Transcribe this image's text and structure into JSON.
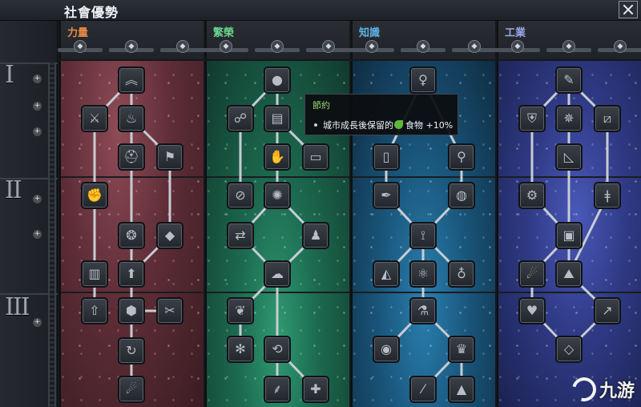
{
  "window": {
    "title": "社會優勢"
  },
  "tiers": [
    "I",
    "II",
    "III"
  ],
  "categories": [
    {
      "label": "力量",
      "color": "#e88a4a",
      "sub_icons": [
        "strength-sub-icon-1",
        "strength-sub-icon-2",
        "strength-sub-icon-3"
      ],
      "nodes": [
        {
          "icon": "chevron-rank-icon",
          "glyph": "︽"
        },
        {
          "icon": "sword-icon",
          "glyph": "⚔"
        },
        {
          "icon": "torch-icon",
          "glyph": "♨"
        },
        {
          "icon": "helmet-icon",
          "glyph": "⛑"
        },
        {
          "icon": "flag-icon",
          "glyph": "⚑"
        },
        {
          "icon": "fist-icon",
          "glyph": "✊"
        },
        {
          "icon": "swirl-icon",
          "glyph": "❂"
        },
        {
          "icon": "gem-icon",
          "glyph": "◆"
        },
        {
          "icon": "pillar-icon",
          "glyph": "▥"
        },
        {
          "icon": "arrow-up-icon",
          "glyph": "⬆"
        },
        {
          "icon": "arrow-up-circle-icon",
          "glyph": "⇧"
        },
        {
          "icon": "hexagon-icon",
          "glyph": "⬢"
        },
        {
          "icon": "crossed-blades-icon",
          "glyph": "✂"
        },
        {
          "icon": "cycle-icon",
          "glyph": "↻"
        },
        {
          "icon": "comet-icon",
          "glyph": "☄"
        }
      ]
    },
    {
      "label": "繁榮",
      "color": "#6ad38a",
      "sub_icons": [
        "prosperity-sub-icon-1",
        "prosperity-sub-icon-2",
        "prosperity-sub-icon-3"
      ],
      "nodes": [
        {
          "icon": "apple-icon",
          "glyph": "●"
        },
        {
          "icon": "handshake-icon",
          "glyph": "☍"
        },
        {
          "icon": "bar-growth-icon",
          "glyph": "▤"
        },
        {
          "icon": "hand-icon",
          "glyph": "✋"
        },
        {
          "icon": "book-icon",
          "glyph": "▭"
        },
        {
          "icon": "no-sign-icon",
          "glyph": "⊘"
        },
        {
          "icon": "sun-rays-icon",
          "glyph": "✺"
        },
        {
          "icon": "arrows-exchange-icon",
          "glyph": "⇄"
        },
        {
          "icon": "villager-icon",
          "glyph": "♟"
        },
        {
          "icon": "brain-icon",
          "glyph": "☁"
        },
        {
          "icon": "leaves-icon",
          "glyph": "❦"
        },
        {
          "icon": "snowflake-icon",
          "glyph": "✻"
        },
        {
          "icon": "cycle-leaf-icon",
          "glyph": "⟲"
        },
        {
          "icon": "palm-tree-icon",
          "glyph": "⸙"
        },
        {
          "icon": "cross-icon",
          "glyph": "✚"
        }
      ]
    },
    {
      "label": "知識",
      "color": "#5cb3e6",
      "sub_icons": [
        "knowledge-sub-icon-1",
        "knowledge-sub-icon-2",
        "knowledge-sub-icon-3"
      ],
      "nodes": [
        {
          "icon": "lightbulb-icon",
          "glyph": "♀"
        },
        {
          "icon": "scroll-icon",
          "glyph": "▯"
        },
        {
          "icon": "lamp-icon",
          "glyph": "⚲"
        },
        {
          "icon": "quill-icon",
          "glyph": "✒"
        },
        {
          "icon": "globe-icon",
          "glyph": "◍"
        },
        {
          "icon": "branch-icon",
          "glyph": "⟟"
        },
        {
          "icon": "prism-icon",
          "glyph": "◭"
        },
        {
          "icon": "atom-icon",
          "glyph": "⚛"
        },
        {
          "icon": "planet-icon",
          "glyph": "♁"
        },
        {
          "icon": "microscope-icon",
          "glyph": "⚗"
        },
        {
          "icon": "eye-icon",
          "glyph": "◉"
        },
        {
          "icon": "graduation-cap-icon",
          "glyph": "♛"
        },
        {
          "icon": "wand-icon",
          "glyph": "⁄"
        },
        {
          "icon": "pyramid-icon",
          "glyph": "▲"
        }
      ]
    },
    {
      "label": "工業",
      "color": "#9aa7e6",
      "sub_icons": [
        "industry-sub-icon-1",
        "industry-sub-icon-2",
        "industry-sub-icon-3"
      ],
      "nodes": [
        {
          "icon": "wrench-icon",
          "glyph": "✎"
        },
        {
          "icon": "shield-gear-icon",
          "glyph": "⛨"
        },
        {
          "icon": "star-burst-icon",
          "glyph": "✵"
        },
        {
          "icon": "diagonal-icon",
          "glyph": "⧄"
        },
        {
          "icon": "set-square-icon",
          "glyph": "◺"
        },
        {
          "icon": "gear-circle-icon",
          "glyph": "⚙"
        },
        {
          "icon": "spanner-icon",
          "glyph": "ǂ"
        },
        {
          "icon": "crate-icon",
          "glyph": "▣"
        },
        {
          "icon": "meteor-icon",
          "glyph": "☄"
        },
        {
          "icon": "mountain-icon",
          "glyph": "⛰"
        },
        {
          "icon": "heart-hand-icon",
          "glyph": "♥"
        },
        {
          "icon": "trend-arrow-icon",
          "glyph": "↗"
        },
        {
          "icon": "diamond-icon",
          "glyph": "◇"
        }
      ]
    }
  ],
  "tooltip": {
    "title": "節約",
    "text_before": "城市成長後保留的",
    "text_after": "食物 +10%"
  },
  "watermark": {
    "text": "九游"
  }
}
